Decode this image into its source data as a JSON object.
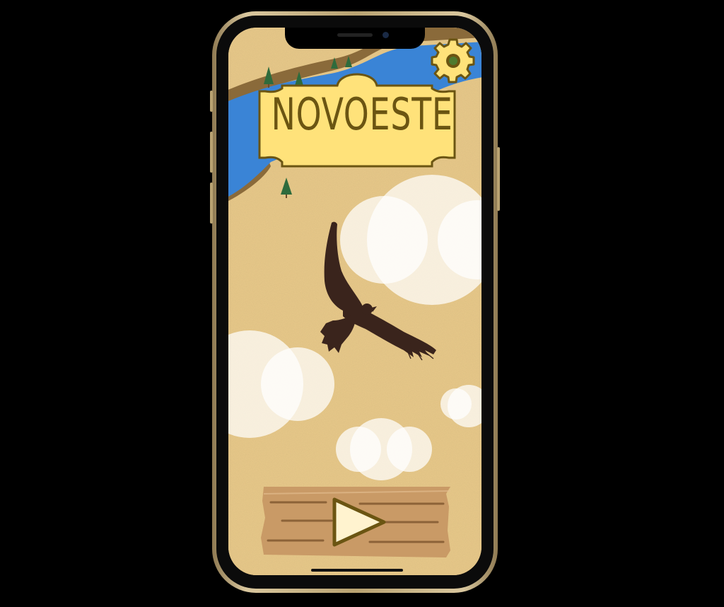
{
  "game": {
    "title": "NOVOESTE"
  },
  "icons": {
    "settings": "gear-icon",
    "play": "play-icon",
    "mascot": "eagle-silhouette"
  },
  "colors": {
    "sand": "#e8c98a",
    "river": "#3a84d6",
    "sign": "#ffe27a",
    "sign_border": "#6b5512",
    "wood": "#c99a66",
    "eagle": "#3a241c"
  }
}
